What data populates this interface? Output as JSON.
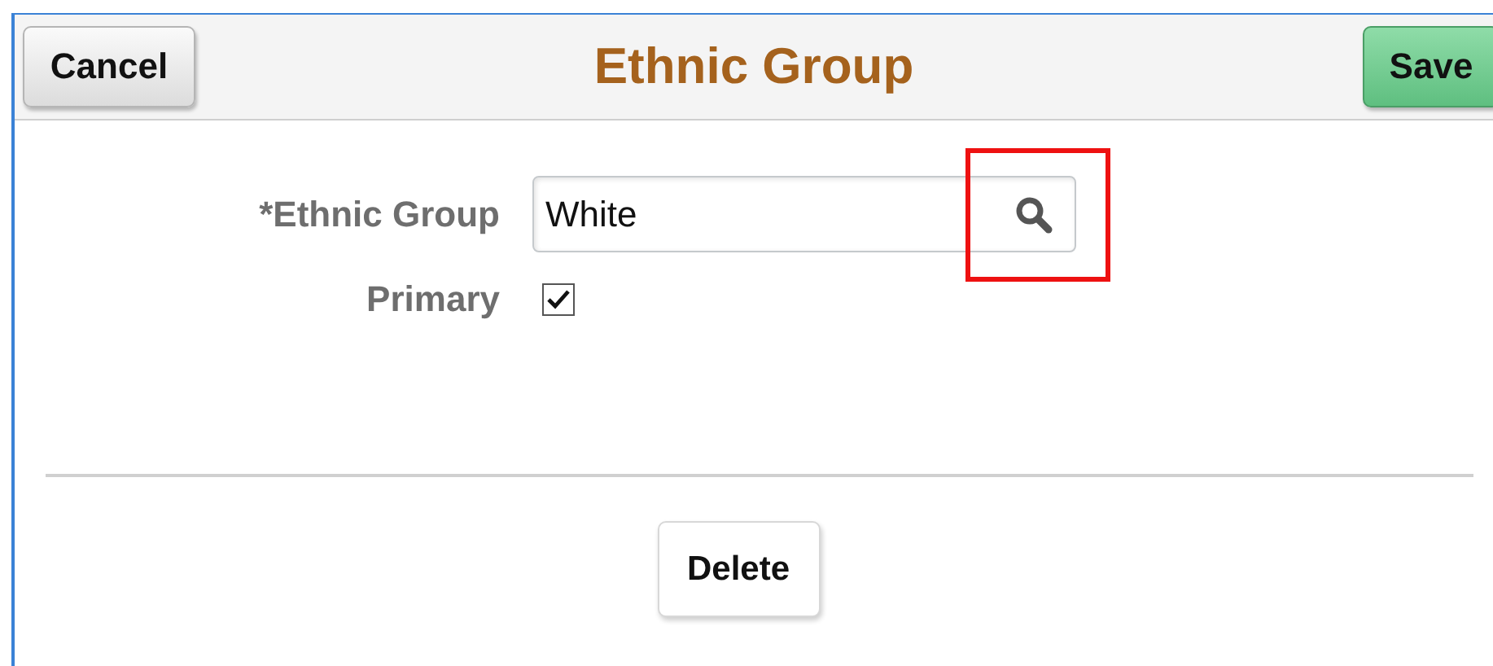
{
  "header": {
    "cancel": "Cancel",
    "title": "Ethnic Group",
    "save": "Save"
  },
  "fields": [
    {
      "kind": "lookup",
      "label": "*Ethnic Group",
      "value": "White",
      "highlighted": true
    },
    {
      "kind": "checkbox",
      "label": "Primary",
      "checked": true
    }
  ],
  "actions": [
    "Delete"
  ]
}
